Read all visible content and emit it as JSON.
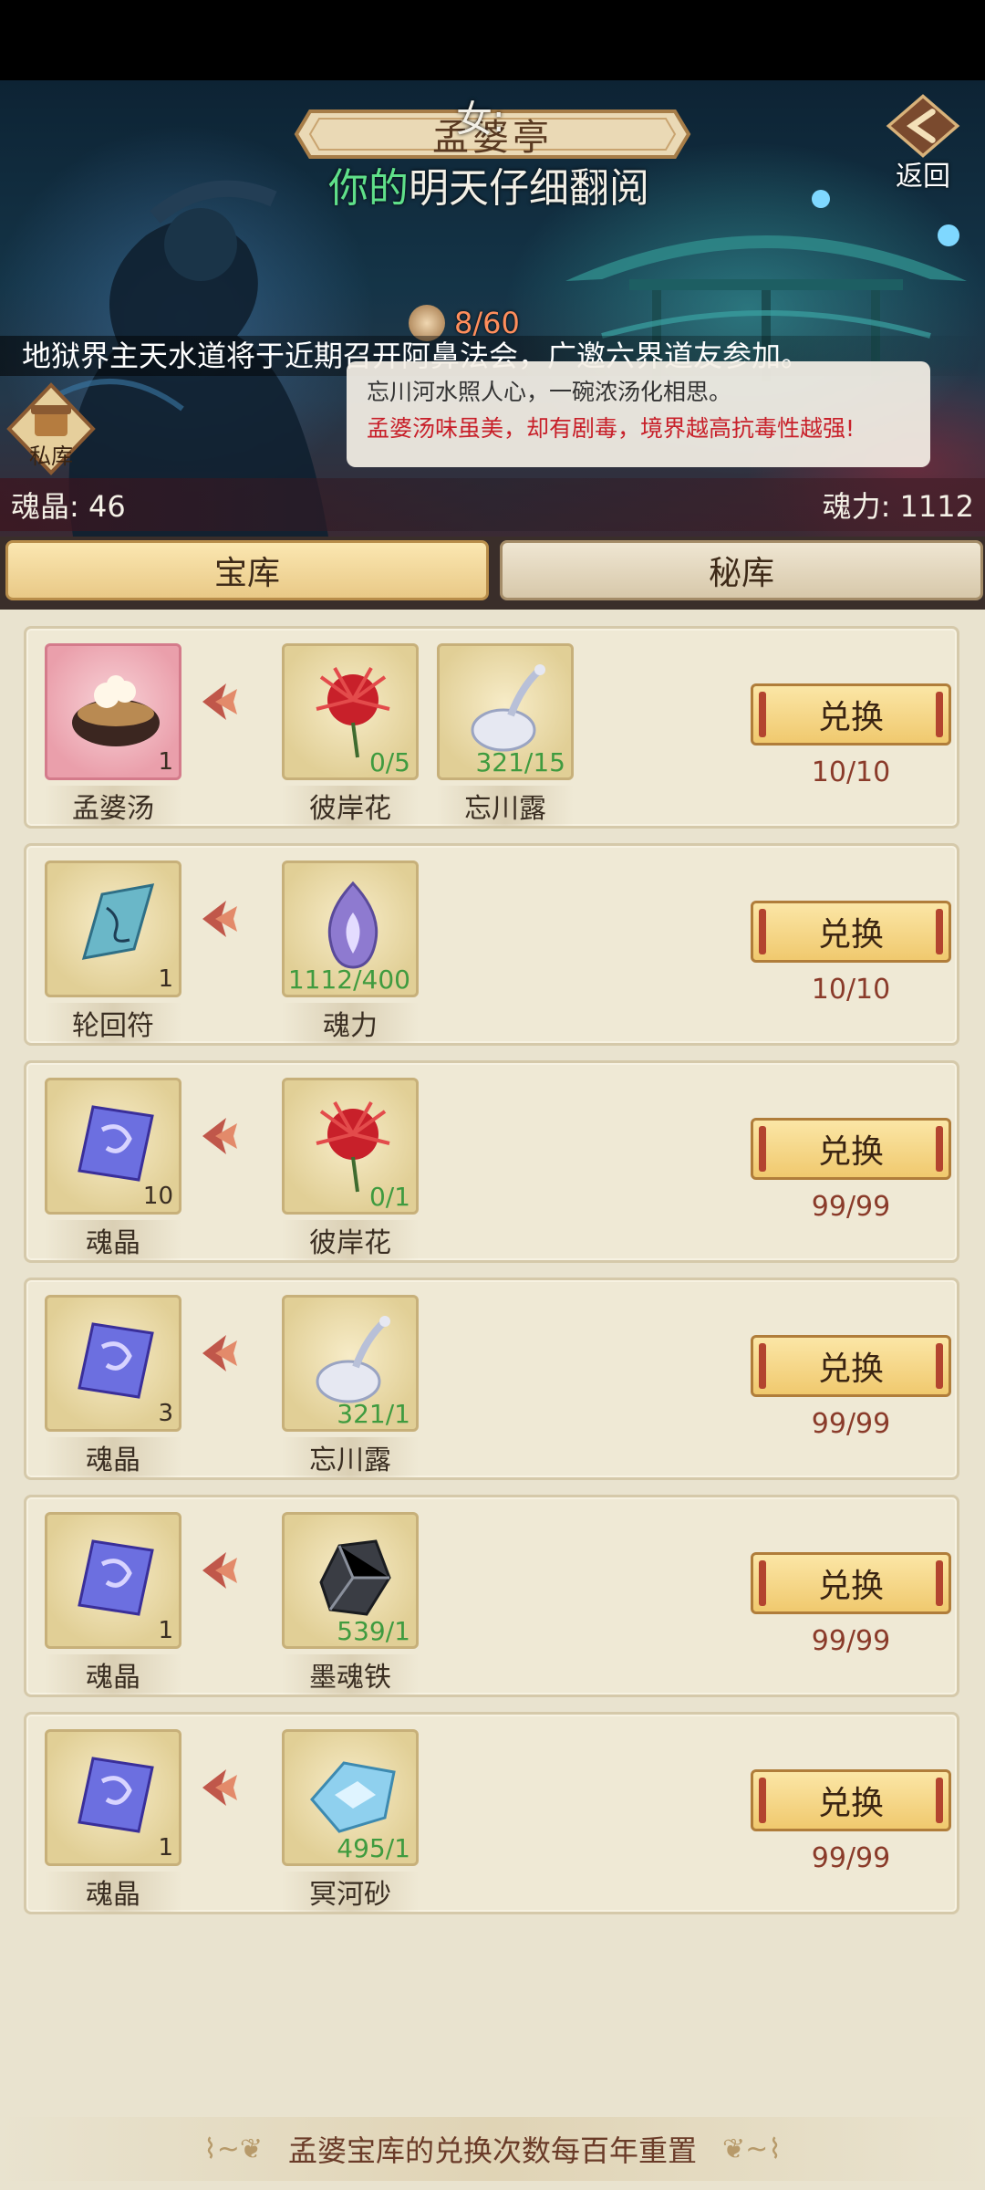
{
  "banner": {
    "title": "孟婆亭",
    "overlay_line1": "女:",
    "overlay_line2_highlight": "你的",
    "overlay_line2_rest": "明天仔细翻阅",
    "return_label": "返回",
    "counter": "8/60",
    "announcement": "地狱界主天水道将于近期召开阿鼻法会，广邀六界道友参加。",
    "speech_line1": "忘川河水照人心，一碗浓汤化相思。",
    "speech_line2": "孟婆汤味虽美，却有剧毒，境界越高抗毒性越强!",
    "private_label": "私库",
    "soul_crystal": "魂晶: 46",
    "soul_power": "魂力: 1112"
  },
  "tabs": {
    "treasury": "宝库",
    "secret": "秘库"
  },
  "rows": [
    {
      "result": {
        "name": "孟婆汤",
        "count": "1",
        "icon": "soup-icon"
      },
      "costs": [
        {
          "name": "彼岸花",
          "need": "0/5",
          "icon": "red-spider-lily-icon"
        },
        {
          "name": "忘川露",
          "need": "321/15",
          "icon": "dew-flask-icon"
        }
      ],
      "button": "兑换",
      "limit": "10/10"
    },
    {
      "result": {
        "name": "轮回符",
        "count": "1",
        "icon": "talisman-icon"
      },
      "costs": [
        {
          "name": "魂力",
          "need": "1112/400",
          "icon": "soul-flame-icon"
        }
      ],
      "button": "兑换",
      "limit": "10/10"
    },
    {
      "result": {
        "name": "魂晶",
        "count": "10",
        "icon": "soul-crystal-icon"
      },
      "costs": [
        {
          "name": "彼岸花",
          "need": "0/1",
          "icon": "red-spider-lily-icon"
        }
      ],
      "button": "兑换",
      "limit": "99/99"
    },
    {
      "result": {
        "name": "魂晶",
        "count": "3",
        "icon": "soul-crystal-icon"
      },
      "costs": [
        {
          "name": "忘川露",
          "need": "321/1",
          "icon": "dew-flask-icon"
        }
      ],
      "button": "兑换",
      "limit": "99/99"
    },
    {
      "result": {
        "name": "魂晶",
        "count": "1",
        "icon": "soul-crystal-icon"
      },
      "costs": [
        {
          "name": "墨魂铁",
          "need": "539/1",
          "icon": "black-ore-icon"
        }
      ],
      "button": "兑换",
      "limit": "99/99"
    },
    {
      "result": {
        "name": "魂晶",
        "count": "1",
        "icon": "soul-crystal-icon"
      },
      "costs": [
        {
          "name": "冥河砂",
          "need": "495/1",
          "icon": "blue-sand-icon"
        }
      ],
      "button": "兑换",
      "limit": "99/99"
    }
  ],
  "footer": {
    "note": "孟婆宝库的兑换次数每百年重置"
  },
  "colors": {
    "accent_gold": "#f0c96e",
    "need_green": "#3f9b3f",
    "limit_red": "#8a3b2a"
  }
}
